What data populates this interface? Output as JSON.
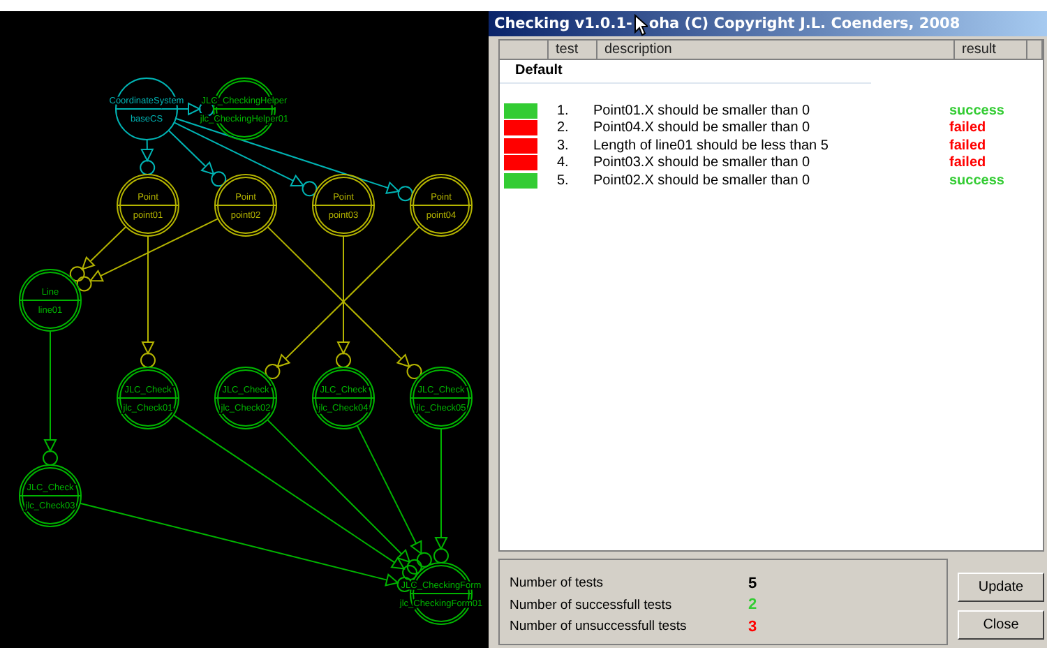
{
  "diagram": {
    "nodes": [
      {
        "kind": "single",
        "label": "CoordinateSystem",
        "name": "baseCS",
        "color": "#00b4b4"
      },
      {
        "kind": "double",
        "label": "JLC_CheckingHelper",
        "name": "jlc_CheckingHelper01",
        "color": "#00b400"
      },
      {
        "kind": "double",
        "label": "Point",
        "name": "point01",
        "color": "#b4b400"
      },
      {
        "kind": "double",
        "label": "Point",
        "name": "point02",
        "color": "#b4b400"
      },
      {
        "kind": "double",
        "label": "Point",
        "name": "point03",
        "color": "#b4b400"
      },
      {
        "kind": "double",
        "label": "Point",
        "name": "point04",
        "color": "#b4b400"
      },
      {
        "kind": "double",
        "label": "Line",
        "name": "line01",
        "color": "#00b400"
      },
      {
        "kind": "double",
        "label": "JLC_Check",
        "name": "jlc_Check01",
        "color": "#00b400"
      },
      {
        "kind": "double",
        "label": "JLC_Check",
        "name": "jlc_Check02",
        "color": "#00b400"
      },
      {
        "kind": "double",
        "label": "JLC_Check",
        "name": "jlc_Check04",
        "color": "#00b400"
      },
      {
        "kind": "double",
        "label": "JLC_Check",
        "name": "jlc_Check05",
        "color": "#00b400"
      },
      {
        "kind": "double",
        "label": "JLC_Check",
        "name": "jlc_Check03",
        "color": "#00b400"
      },
      {
        "kind": "double",
        "label": "JLC_CheckingForm",
        "name": "jlc_CheckingForm01",
        "color": "#00b400"
      }
    ]
  },
  "window": {
    "title_before_cursor": "Checking v1.0.1-",
    "title_after_cursor": "oha (C) Copyright J.L. Coenders, 2008"
  },
  "table": {
    "columns": [
      "test",
      "description",
      "result"
    ],
    "group": "Default",
    "rows": [
      {
        "passed": true,
        "number": "1.",
        "description": "Point01.X should be smaller than 0",
        "result": "success"
      },
      {
        "passed": false,
        "number": "2.",
        "description": "Point04.X should be smaller than 0",
        "result": "failed"
      },
      {
        "passed": false,
        "number": "3.",
        "description": "Length of line01 should be less than 5",
        "result": "failed"
      },
      {
        "passed": false,
        "number": "4.",
        "description": "Point03.X should be smaller than 0",
        "result": "failed"
      },
      {
        "passed": true,
        "number": "5.",
        "description": "Point02.X should be smaller than 0",
        "result": "success"
      }
    ]
  },
  "summary": [
    {
      "kind": "total",
      "label": "Number of tests",
      "value": "5"
    },
    {
      "kind": "success",
      "label": "Number of successfull tests",
      "value": "2"
    },
    {
      "kind": "failed",
      "label": "Number of unsuccessfull tests",
      "value": "3"
    }
  ],
  "buttons": [
    "Update",
    "Close"
  ]
}
